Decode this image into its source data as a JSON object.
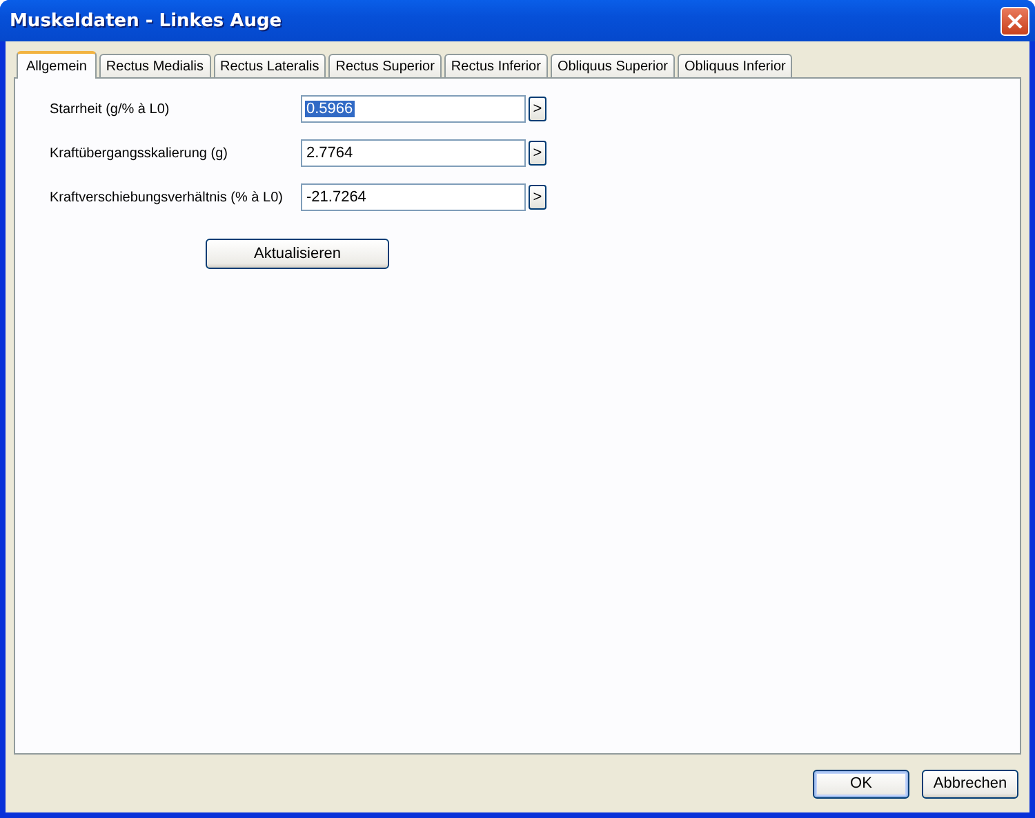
{
  "window": {
    "title": "Muskeldaten - Linkes Auge"
  },
  "tabs": [
    {
      "label": "Allgemein",
      "selected": true
    },
    {
      "label": "Rectus Medialis",
      "selected": false
    },
    {
      "label": "Rectus Lateralis",
      "selected": false
    },
    {
      "label": "Rectus Superior",
      "selected": false
    },
    {
      "label": "Rectus Inferior",
      "selected": false
    },
    {
      "label": "Obliquus Superior",
      "selected": false
    },
    {
      "label": "Obliquus Inferior",
      "selected": false
    }
  ],
  "fields": [
    {
      "label": "Starrheit (g/% à L0)",
      "value": "0.5966",
      "text_highlighted": true,
      "button": ">"
    },
    {
      "label": "Kraftübergangsskalierung (g)",
      "value": "2.7764",
      "text_highlighted": false,
      "button": ">"
    },
    {
      "label": "Kraftverschiebungsverhältnis (% à L0)",
      "value": "-21.7264",
      "text_highlighted": false,
      "button": ">"
    }
  ],
  "update_button": "Aktualisieren",
  "buttons": [
    {
      "label": "OK",
      "default": true
    },
    {
      "label": "Abbrechen",
      "default": false
    }
  ]
}
